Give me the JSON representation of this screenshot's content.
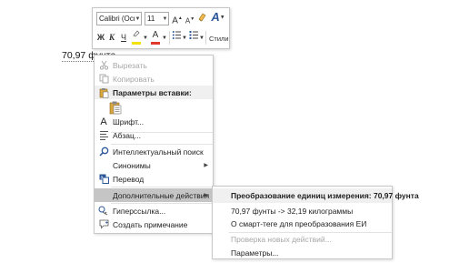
{
  "toolbar": {
    "font_name": "Calibri (Осн",
    "font_size": "11",
    "grow_font": "A",
    "shrink_font": "A",
    "clear_format": "A",
    "styles_icon": "A",
    "bold": "Ж",
    "italic": "К",
    "underline": "Ч",
    "font_color_letter": "A",
    "styles_label": "Стили",
    "highlight_color": "#f4e00b",
    "font_color": "#e03a2f",
    "styles_color": "#2b579a"
  },
  "document": {
    "word": "70,97 фунта"
  },
  "context_menu": {
    "items": [
      {
        "label": "Вырезать",
        "icon": "scissors-icon"
      },
      {
        "label": "Копировать",
        "icon": "copy-icon"
      },
      {
        "label": "Параметры вставки:",
        "icon": "paste-icon"
      },
      {
        "label": "Шрифт...",
        "icon": "font-icon"
      },
      {
        "label": "Абзац...",
        "icon": "paragraph-icon"
      },
      {
        "label": "Интеллектуальный поиск",
        "icon": "smart-lookup-icon"
      },
      {
        "label": "Синонимы",
        "icon": ""
      },
      {
        "label": "Перевод",
        "icon": "translate-icon"
      },
      {
        "label": "Дополнительные действия",
        "icon": ""
      },
      {
        "label": "Гиперссылка...",
        "icon": "hyperlink-icon"
      },
      {
        "label": "Создать примечание",
        "icon": "new-comment-icon"
      }
    ]
  },
  "submenu": {
    "header": "Преобразование единиц измерения: 70,97 фунта",
    "items": [
      {
        "label": "70,97 фунты -> 32,19 килограммы"
      },
      {
        "label": "О смарт-теге для преобразования ЕИ"
      },
      {
        "label": "Проверка новых действий..."
      },
      {
        "label": "Параметры..."
      }
    ]
  }
}
